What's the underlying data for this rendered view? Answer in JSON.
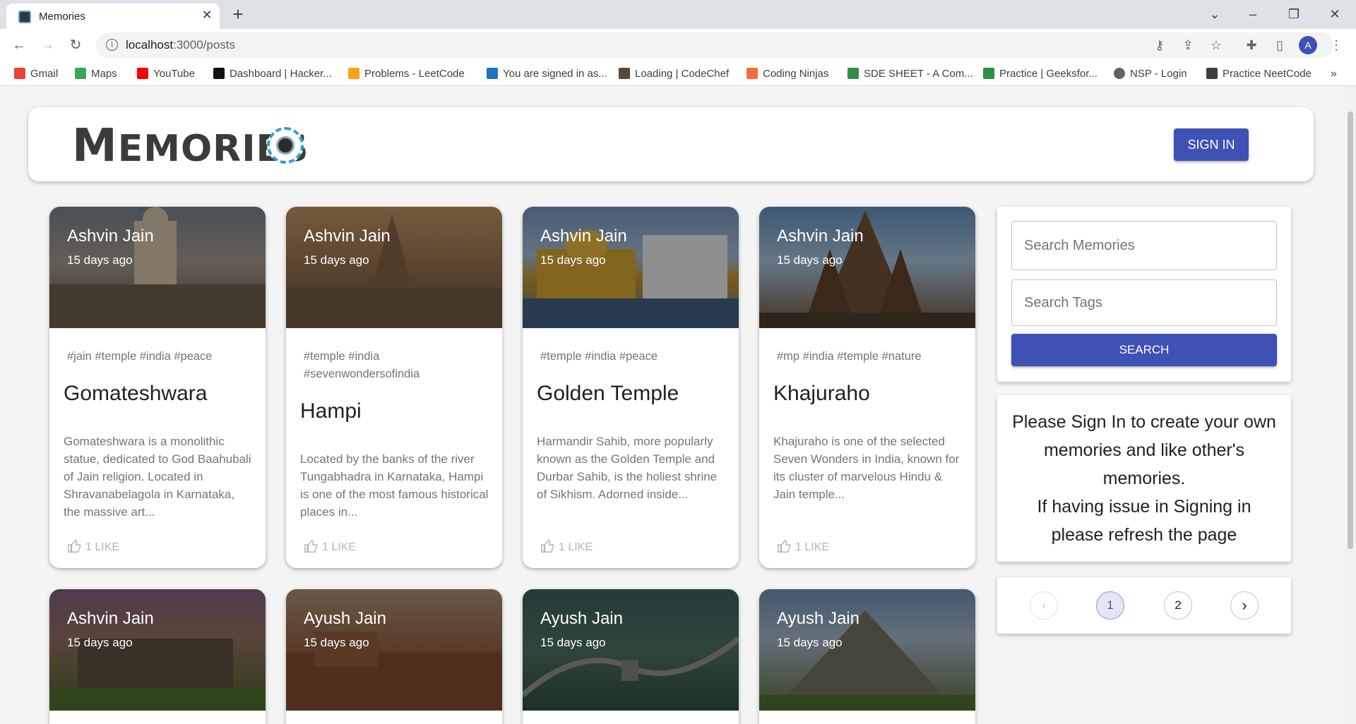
{
  "browser": {
    "tab_title": "Memories",
    "url_host": "localhost",
    "url_path": ":3000/posts",
    "bookmarks": [
      {
        "label": "Gmail",
        "icon": "gmail-icon",
        "color": "#ea4335"
      },
      {
        "label": "Maps",
        "icon": "maps-icon",
        "color": "#34a853"
      },
      {
        "label": "YouTube",
        "icon": "youtube-icon",
        "color": "#ff0000"
      },
      {
        "label": "Dashboard | Hacker...",
        "icon": "hackerrank-icon",
        "color": "#111111"
      },
      {
        "label": "Problems - LeetCode",
        "icon": "leetcode-icon",
        "color": "#ffa116"
      },
      {
        "label": "You are signed in as...",
        "icon": "spoj-icon",
        "color": "#1e73be"
      },
      {
        "label": "Loading | CodeChef",
        "icon": "codechef-icon",
        "color": "#5b4638"
      },
      {
        "label": "Coding Ninjas",
        "icon": "codingninjas-icon",
        "color": "#f66c3b"
      },
      {
        "label": "SDE SHEET - A Com...",
        "icon": "geeksforgeeks-icon",
        "color": "#2f8d46"
      },
      {
        "label": "Practice | Geeksfor...",
        "icon": "geeksforgeeks-icon",
        "color": "#2f8d46"
      },
      {
        "label": "NSP - Login",
        "icon": "globe-icon",
        "color": "#5f6368"
      },
      {
        "label": "Practice NeetCode",
        "icon": "neetcode-icon",
        "color": "#3c4043"
      }
    ],
    "avatar_letter": "A"
  },
  "app": {
    "brand_first": "M",
    "brand_rest": "EMORIES",
    "sign_in_label": "SIGN IN",
    "accent": "#3f51b5"
  },
  "posts": [
    {
      "creator": "Ashvin Jain",
      "time": "15 days ago",
      "tags": "#jain #temple #india #peace",
      "title": "Gomateshwara",
      "description": "Gomateshwara is a monolithic statue, dedicated to God Baahubali of Jain religion. Located in Shravanabelagola in Karnataka, the massive art...",
      "likes": "1 LIKE"
    },
    {
      "creator": "Ashvin Jain",
      "time": "15 days ago",
      "tags": "#temple #india #sevenwondersofindia",
      "title": "Hampi",
      "description": "Located by the banks of the river Tungabhadra in Karnataka, Hampi is one of the most famous historical places in...",
      "likes": "1 LIKE"
    },
    {
      "creator": "Ashvin Jain",
      "time": "15 days ago",
      "tags": "#temple #india #peace",
      "title": "Golden Temple",
      "description": "Harmandir Sahib, more popularly known as the Golden Temple and Durbar Sahib, is the holiest shrine of Sikhism. Adorned inside...",
      "likes": "1 LIKE"
    },
    {
      "creator": "Ashvin Jain",
      "time": "15 days ago",
      "tags": "#mp #india #temple #nature",
      "title": "Khajuraho",
      "description": "Khajuraho is one of the selected Seven Wonders in India, known for its cluster of marvelous Hindu & Jain temple...",
      "likes": "1 LIKE"
    },
    {
      "creator": "Ashvin Jain",
      "time": "15 days ago"
    },
    {
      "creator": "Ayush Jain",
      "time": "15 days ago"
    },
    {
      "creator": "Ayush Jain",
      "time": "15 days ago"
    },
    {
      "creator": "Ayush Jain",
      "time": "15 days ago"
    }
  ],
  "search": {
    "memories_placeholder": "Search Memories",
    "tags_placeholder": "Search Tags",
    "button_label": "SEARCH"
  },
  "notice": {
    "line1": "Please Sign In to create your own memories and like other's memories.",
    "line2": "If having issue in Signing in please refresh the page"
  },
  "pagination": {
    "pages": [
      "1",
      "2"
    ],
    "current": "1"
  }
}
